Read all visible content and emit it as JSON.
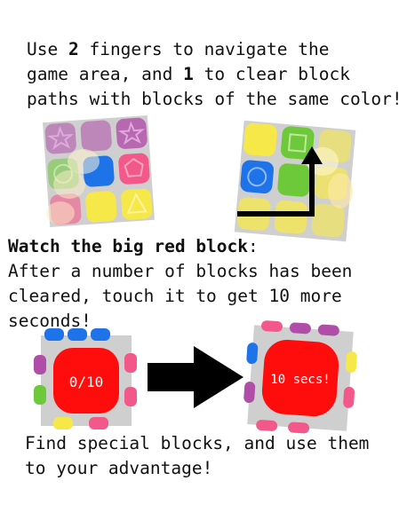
{
  "intro": {
    "line1_a": "Use ",
    "line1_b": "2",
    "line1_c": " fingers to navigate the",
    "line2_a": "game area, and ",
    "line2_b": "1",
    "line2_c": " to clear block",
    "line3": "paths with blocks of the same color!"
  },
  "watch": {
    "heading": "Watch the big red block",
    "colon": ":",
    "line2": "After a number of blocks has been",
    "line3": "cleared, touch it to get 10 more",
    "line4": "seconds!"
  },
  "red_block_before": {
    "label": "0/10"
  },
  "red_block_after": {
    "label": "10 secs!"
  },
  "special": {
    "line1": "Find special blocks, and use them",
    "line2": "to your advantage!"
  },
  "colors": {
    "purple": "#b04da8",
    "pink": "#f2598a",
    "green": "#6ec93a",
    "blue": "#1e73e8",
    "yellow": "#f7e84a",
    "red": "#ff0d0d",
    "grid": "#cfcfcf",
    "arrow": "#000000"
  }
}
